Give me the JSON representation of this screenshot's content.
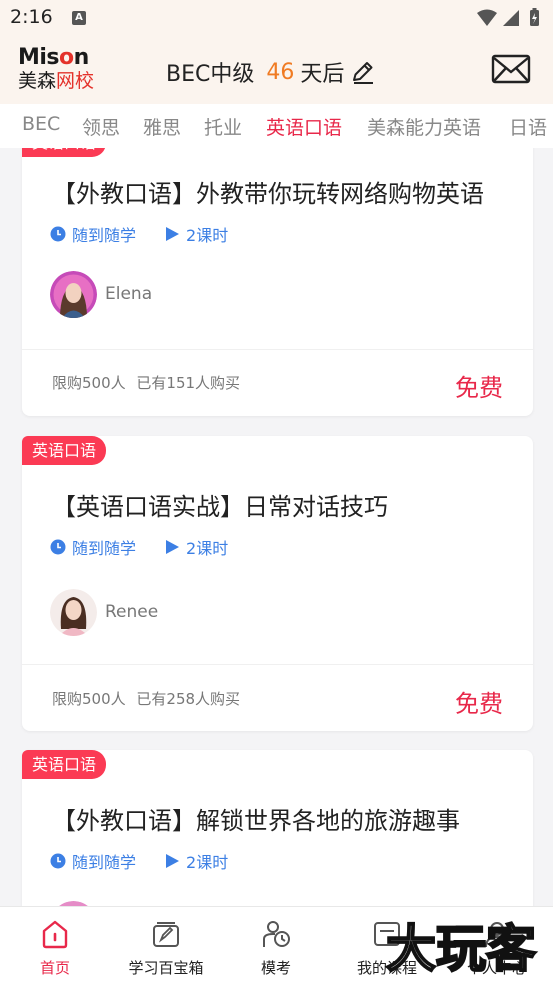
{
  "status_bar": {
    "time": "2:16",
    "notif_letter": "A"
  },
  "header": {
    "logo": {
      "en_main": "Mis",
      "en_accent": "o",
      "en_tail": "n",
      "cn_black": "美森",
      "cn_red": "网校"
    },
    "exam_name": "BEC中级",
    "days": "46",
    "days_suffix": "天后"
  },
  "tabs": [
    {
      "label": "BEC",
      "active": false
    },
    {
      "label": "领思",
      "active": false
    },
    {
      "label": "雅思",
      "active": false
    },
    {
      "label": "托业",
      "active": false
    },
    {
      "label": "英语口语",
      "active": true
    },
    {
      "label": "美森能力英语",
      "active": false
    },
    {
      "label": "日语",
      "active": false
    }
  ],
  "courses": [
    {
      "badge": "英语口语",
      "title": "【外教口语】外教带你玩转网络购物英语",
      "mode": "随到随学",
      "lessons": "2课时",
      "teacher": "Elena",
      "limit": "限购500人",
      "sold": "已有151人购买",
      "price": "免费"
    },
    {
      "badge": "英语口语",
      "title": "【英语口语实战】日常对话技巧",
      "mode": "随到随学",
      "lessons": "2课时",
      "teacher": "Renee",
      "limit": "限购500人",
      "sold": "已有258人购买",
      "price": "免费"
    },
    {
      "badge": "英语口语",
      "title": "【外教口语】解锁世界各地的旅游趣事",
      "mode": "随到随学",
      "lessons": "2课时"
    }
  ],
  "bottom_nav": [
    {
      "label": "首页",
      "icon": "home-icon",
      "active": true
    },
    {
      "label": "学习百宝箱",
      "icon": "toolbox-icon",
      "active": false
    },
    {
      "label": "模考",
      "icon": "mock-exam-icon",
      "active": false
    },
    {
      "label": "我的课程",
      "icon": "my-courses-icon",
      "active": false
    },
    {
      "label": "个人中心",
      "icon": "profile-icon",
      "active": false
    }
  ],
  "watermark": "大玩客",
  "colors": {
    "accent": "#e8284a",
    "badge": "#fb3a54",
    "days": "#f07b23",
    "meta_blue": "#3c7fe4",
    "header_bg": "#fbf4ee"
  }
}
